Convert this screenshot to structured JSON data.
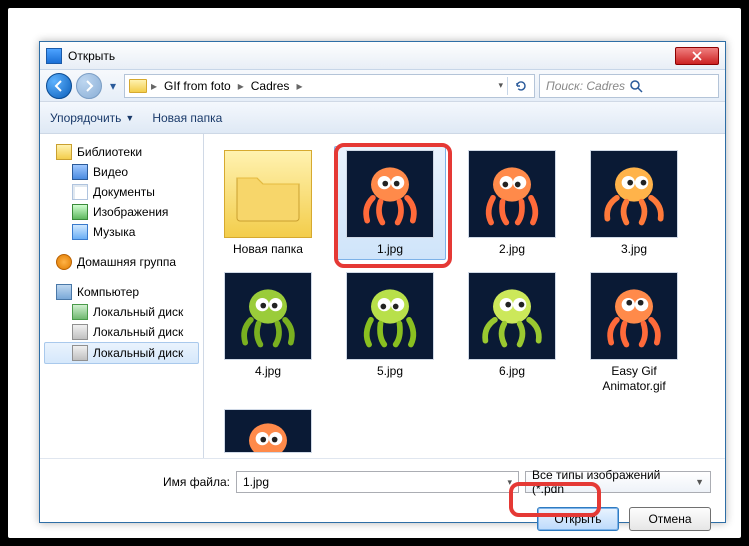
{
  "title": "Открыть",
  "breadcrumb": {
    "seg1": "GIf from foto",
    "seg2": "Cadres"
  },
  "search": {
    "placeholder": "Поиск: Cadres"
  },
  "toolbar": {
    "organize": "Упорядочить",
    "new_folder": "Новая папка"
  },
  "sidebar": {
    "libraries": "Библиотеки",
    "video": "Видео",
    "documents": "Документы",
    "images": "Изображения",
    "music": "Музыка",
    "homegroup": "Домашняя группа",
    "computer": "Компьютер",
    "disk1": "Локальный диск",
    "disk2": "Локальный диск",
    "disk3": "Локальный диск"
  },
  "files": {
    "folder": "Новая папка",
    "f1": "1.jpg",
    "f2": "2.jpg",
    "f3": "3.jpg",
    "f4": "4.jpg",
    "f5": "5.jpg",
    "f6": "6.jpg",
    "f7": "Easy Gif Animator.gif"
  },
  "footer": {
    "filename_label": "Имя файла:",
    "filename_value": "1.jpg",
    "filter": "Все типы изображений (*.pdn",
    "open": "Открыть",
    "cancel": "Отмена"
  }
}
